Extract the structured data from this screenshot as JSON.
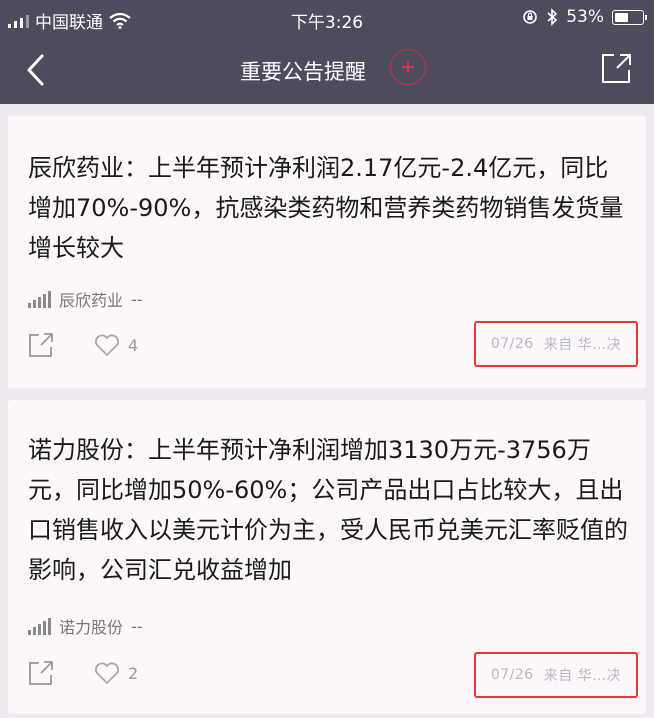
{
  "status_bar": {
    "carrier": "中国联通",
    "time": "下午3:26",
    "battery": "53%",
    "battery_level": 0.53
  },
  "nav": {
    "title": "重要公告提醒"
  },
  "cards": [
    {
      "title": "辰欣药业：上半年预计净利润2.17亿元-2.4亿元，同比增加70%-90%，抗感染类药物和营养类药物销售发货量增长较大",
      "stock_name": "辰欣药业",
      "stock_extra": "--",
      "likes": "4",
      "date": "07/26",
      "source": "来自 华…决"
    },
    {
      "title": "诺力股份：上半年预计净利润增加3130万元-3756万元，同比增加50%-60%；公司产品出口占比较大，且出口销售收入以美元计价为主，受人民币兑美元汇率贬值的影响，公司汇兑收益增加",
      "stock_name": "诺力股份",
      "stock_extra": "--",
      "likes": "2",
      "date": "07/26",
      "source": "来自 华…决"
    }
  ]
}
